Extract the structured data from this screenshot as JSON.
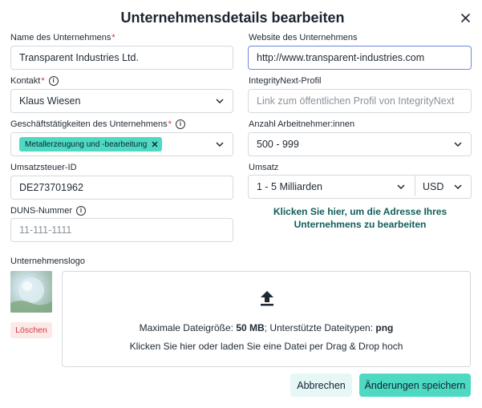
{
  "dialog": {
    "title": "Unternehmensdetails bearbeiten"
  },
  "company_name": {
    "label": "Name des Unternehmens",
    "required": "*",
    "value": "Transparent Industries Ltd."
  },
  "website": {
    "label": "Website des Unternehmens",
    "value": "http://www.transparent-industries.com"
  },
  "contact": {
    "label": "Kontakt",
    "required": "*",
    "selected": "Klaus Wiesen"
  },
  "integrity_profile": {
    "label": "IntegrityNext-Profil",
    "placeholder": "Link zum öffentlichen Profil von IntegrityNext"
  },
  "activities": {
    "label": "Geschäftstätigkeiten des Unternehmens",
    "required": "*",
    "chips": [
      "Metallerzeugung und -bearbeitung"
    ]
  },
  "employees": {
    "label": "Anzahl Arbeitnehmer:innen",
    "selected": "500 - 999"
  },
  "vat": {
    "label": "Umsatzsteuer-ID",
    "value": "DE273701962"
  },
  "revenue": {
    "label": "Umsatz",
    "selected": "1 - 5 Milliarden",
    "currency": "USD"
  },
  "duns": {
    "label": "DUNS-Nummer",
    "placeholder": "11-111-1111"
  },
  "address_link": {
    "line1": "Klicken Sie hier, um die Adresse Ihres",
    "line2": "Unternehmens zu bearbeiten"
  },
  "logo": {
    "label": "Unternehmenslogo",
    "delete_label": "Löschen",
    "max_size_prefix": "Maximale Dateigröße: ",
    "max_size_value": "50 MB",
    "types_prefix": "; Unterstützte Dateitypen: ",
    "types_value": "png",
    "dropzone_hint": "Klicken Sie hier oder laden Sie eine Datei per Drag & Drop hoch"
  },
  "actions": {
    "cancel_label": "Abbrechen",
    "save_label": "Änderungen speichern"
  },
  "icons": {
    "info": "i",
    "close": "close-icon",
    "chevron": "chevron-down-icon",
    "upload": "upload-icon",
    "chip_remove": "x-icon"
  },
  "colors": {
    "accent": "#4dd9c2",
    "accent_light": "#e6f7f5",
    "required": "#d32f2f",
    "link": "#0f5e5a",
    "danger": "#d23a3a",
    "danger_bg": "#fde8e8",
    "focus": "#6f88e0"
  }
}
